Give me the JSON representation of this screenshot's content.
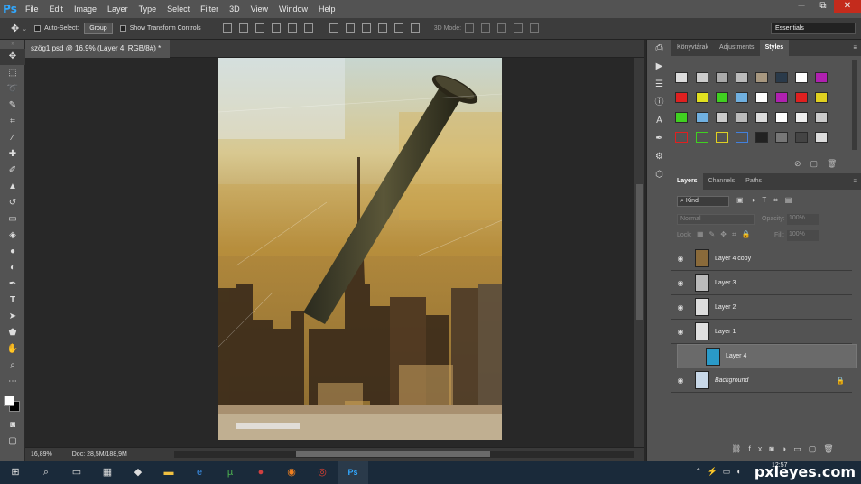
{
  "app": {
    "logo": "Ps",
    "menu": [
      "File",
      "Edit",
      "Image",
      "Layer",
      "Type",
      "Select",
      "Filter",
      "3D",
      "View",
      "Window",
      "Help"
    ],
    "win_controls": [
      "─",
      "⧉",
      "✕"
    ]
  },
  "options": {
    "auto_select": "Auto-Select:",
    "group": "Group",
    "transform": "Show Transform Controls",
    "mode3d": "3D Mode:",
    "workspace": "Essentials"
  },
  "document": {
    "tab_title": "szög1.psd @ 16,9% (Layer 4, RGB/8#) *",
    "zoom": "16,89%",
    "doc_size": "Doc: 28,5M/188,9M"
  },
  "panels": {
    "tabs_top": [
      "Könyvtárak",
      "Adjustments",
      "Styles"
    ],
    "tabs_layers": [
      "Layers",
      "Channels",
      "Paths"
    ],
    "kind": "Kind",
    "blend": "Normal",
    "opacity_label": "Opacity:",
    "opacity": "100%",
    "lock_label": "Lock:",
    "fill_label": "Fill:",
    "fill": "100%"
  },
  "layers": [
    {
      "name": "Layer 4 copy",
      "visible": true,
      "thumb": "#8a6a3a"
    },
    {
      "name": "Layer 3",
      "visible": true,
      "thumb": "#bbbbbb"
    },
    {
      "name": "Layer 2",
      "visible": true,
      "thumb": "#dddddd"
    },
    {
      "name": "Layer 1",
      "visible": true,
      "thumb": "#e0e0e0"
    },
    {
      "name": "Layer 4",
      "visible": false,
      "selected": true,
      "thumb": "#2a9ac8"
    },
    {
      "name": "Background",
      "visible": true,
      "italic": true,
      "locked": true,
      "thumb": "#c8d8e8"
    }
  ],
  "taskbar": {
    "time": "12:57"
  },
  "watermark": "pxleyes.com"
}
